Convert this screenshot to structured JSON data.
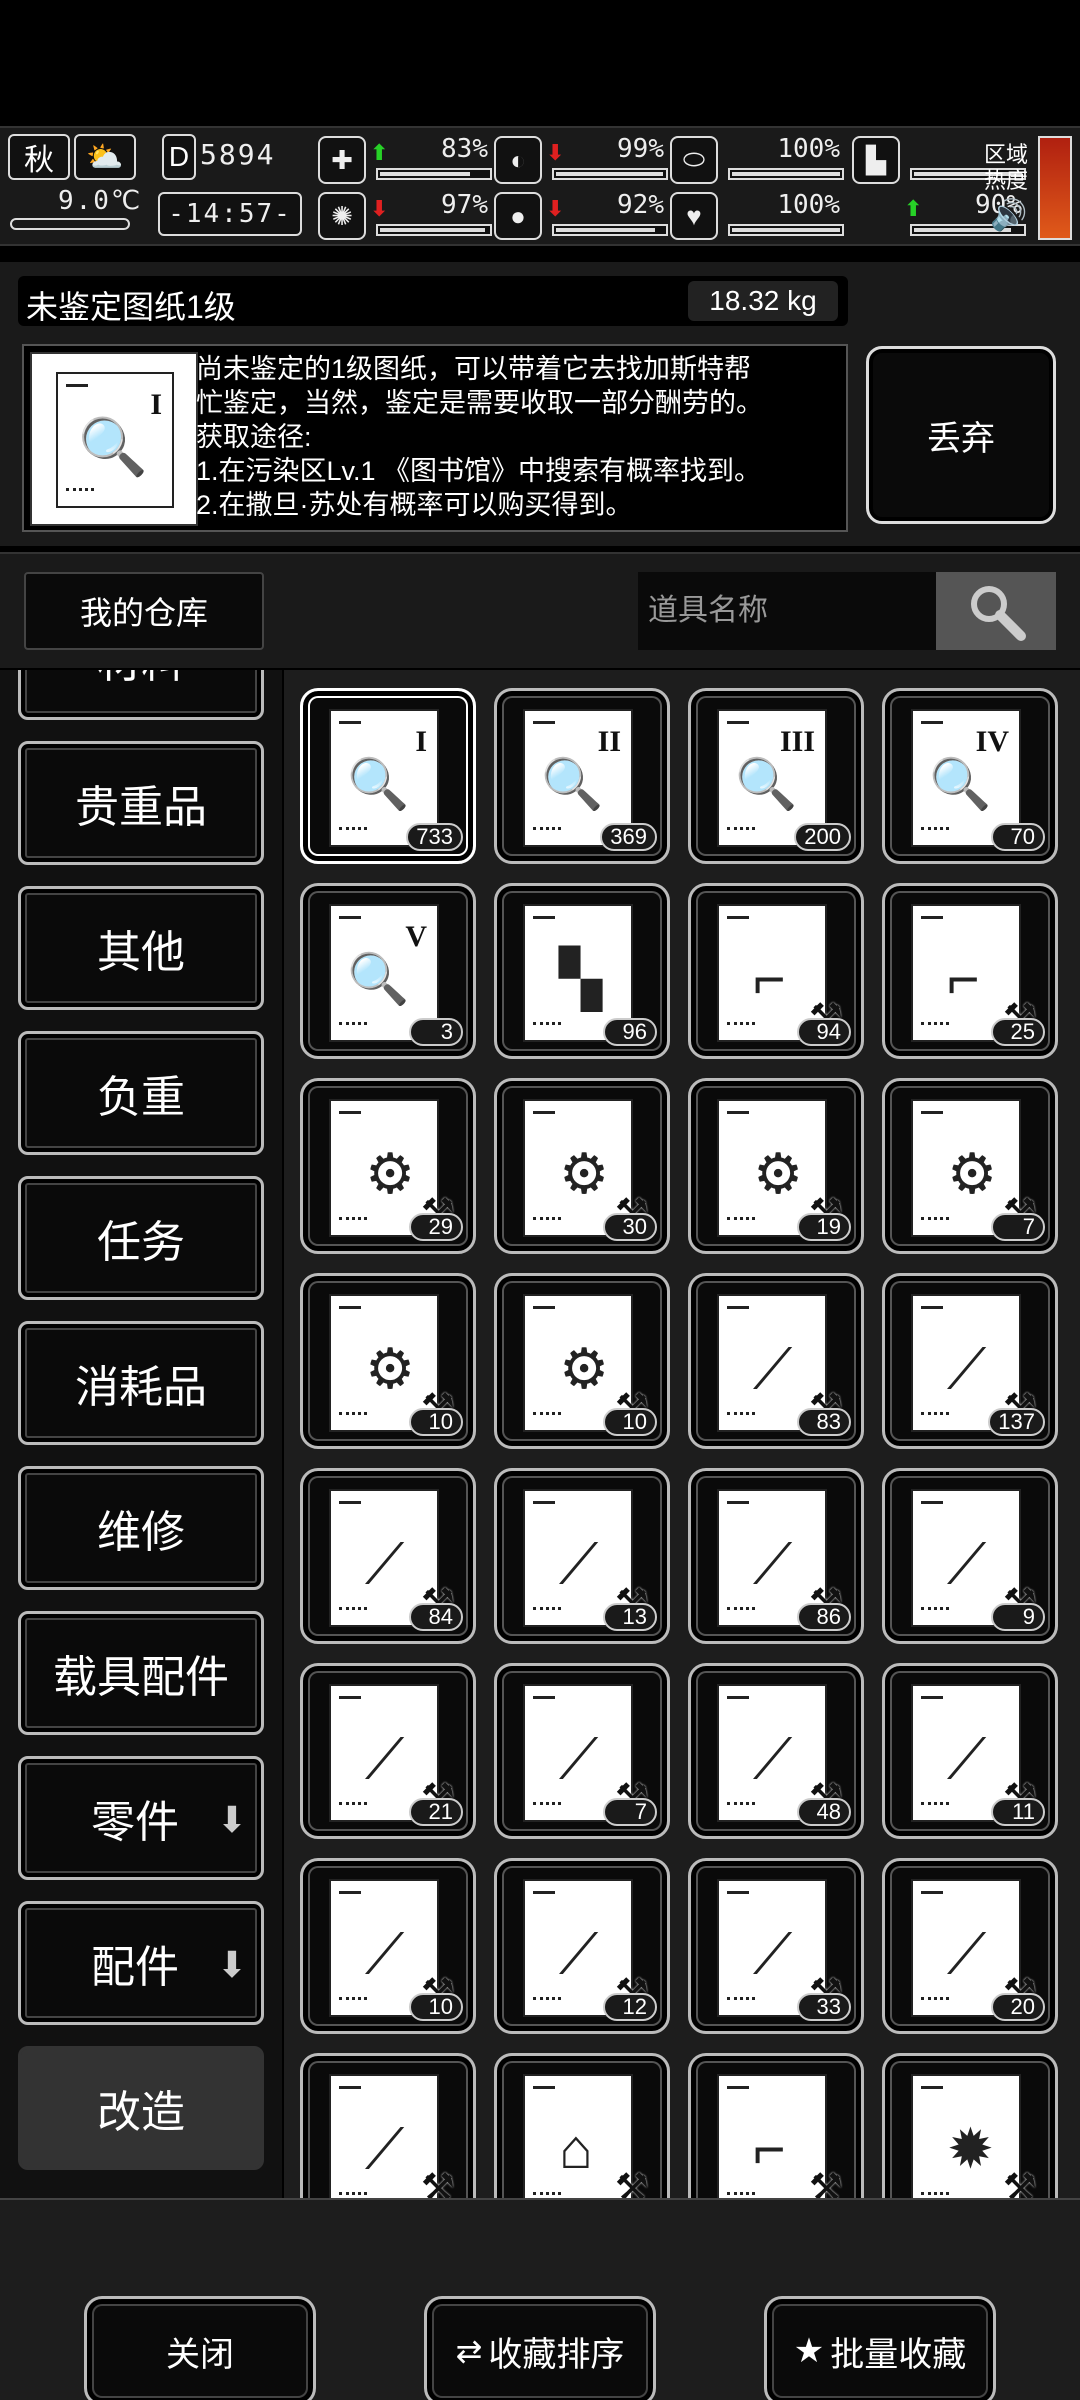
{
  "status": {
    "season": "秋",
    "temperature": "9.0℃",
    "day_counter": "5894",
    "day_prefix": "D",
    "clock": "-14:57-",
    "stats": [
      {
        "name": "health",
        "icon": "medkit-icon",
        "glyph": "✚",
        "trend": "up",
        "percent": "83%",
        "level": 0.83
      },
      {
        "name": "hunger",
        "icon": "stomach-icon",
        "glyph": "◐",
        "trend": "down",
        "percent": "99%",
        "level": 0.99
      },
      {
        "name": "stamina",
        "icon": "pill-icon",
        "glyph": "⬭",
        "trend": "none",
        "percent": "100%",
        "level": 1.0
      },
      {
        "name": "footwear",
        "icon": "boot-icon",
        "glyph": "▙",
        "trend": "none",
        "percent": "",
        "level": 1.0
      },
      {
        "name": "mind",
        "icon": "brain-icon",
        "glyph": "✺",
        "trend": "down",
        "percent": "97%",
        "level": 0.97
      },
      {
        "name": "thirst",
        "icon": "water-drop-icon",
        "glyph": "●",
        "trend": "down",
        "percent": "92%",
        "level": 0.92
      },
      {
        "name": "heart",
        "icon": "heart-icon",
        "glyph": "♥",
        "trend": "none",
        "percent": "100%",
        "level": 1.0
      },
      {
        "name": "energy",
        "icon": "none",
        "glyph": "",
        "trend": "up",
        "percent": "90%",
        "level": 0.9
      }
    ],
    "zone_heat_label": "区域\n热度",
    "zone_heat_color": "#e05a1a"
  },
  "selected_item": {
    "name": "未鉴定图纸1级",
    "weight": "18.32 kg",
    "description": "尚未鉴定的1级图纸，可以带着它去找加斯特帮\n忙鉴定，当然，鉴定是需要收取一部分酬劳的。\n获取途径:\n1.在污染区Lv.1 《图书馆》中搜索有概率找到。\n2.在撒旦·苏处有概率可以购买得到。",
    "roman": "I",
    "discard_label": "丢弃"
  },
  "storage": {
    "title": "我的仓库",
    "search_placeholder": "道具名称"
  },
  "categories": [
    {
      "label": "材料",
      "active": false,
      "arrow": false
    },
    {
      "label": "贵重品",
      "active": false,
      "arrow": false
    },
    {
      "label": "其他",
      "active": false,
      "arrow": false
    },
    {
      "label": "负重",
      "active": false,
      "arrow": false
    },
    {
      "label": "任务",
      "active": false,
      "arrow": false
    },
    {
      "label": "消耗品",
      "active": false,
      "arrow": false
    },
    {
      "label": "维修",
      "active": false,
      "arrow": false
    },
    {
      "label": "载具配件",
      "active": false,
      "arrow": false
    },
    {
      "label": "零件",
      "active": false,
      "arrow": true
    },
    {
      "label": "配件",
      "active": false,
      "arrow": true
    },
    {
      "label": "改造",
      "active": true,
      "arrow": false
    }
  ],
  "items": [
    {
      "kind": "blueprint",
      "roman": "I",
      "count": "733",
      "selected": true
    },
    {
      "kind": "blueprint",
      "roman": "II",
      "count": "369"
    },
    {
      "kind": "blueprint",
      "roman": "III",
      "count": "200"
    },
    {
      "kind": "blueprint",
      "roman": "IV",
      "count": "70"
    },
    {
      "kind": "blueprint",
      "roman": "V",
      "count": "3"
    },
    {
      "kind": "torn",
      "glyph": "▚",
      "count": "96"
    },
    {
      "kind": "mod",
      "glyph": "⌐",
      "count": "94"
    },
    {
      "kind": "mod",
      "glyph": "⌐",
      "count": "25"
    },
    {
      "kind": "mod",
      "glyph": "⚙",
      "count": "29"
    },
    {
      "kind": "mod",
      "glyph": "⚙",
      "count": "30"
    },
    {
      "kind": "mod",
      "glyph": "⚙",
      "count": "19"
    },
    {
      "kind": "mod",
      "glyph": "⚙",
      "count": "7"
    },
    {
      "kind": "mod",
      "glyph": "⚙",
      "count": "10"
    },
    {
      "kind": "mod",
      "glyph": "⚙",
      "count": "10"
    },
    {
      "kind": "mod",
      "glyph": "⟋",
      "count": "83"
    },
    {
      "kind": "mod",
      "glyph": "⟋",
      "count": "137"
    },
    {
      "kind": "mod",
      "glyph": "⟋",
      "count": "84"
    },
    {
      "kind": "mod",
      "glyph": "⟋",
      "count": "13"
    },
    {
      "kind": "mod",
      "glyph": "⟋",
      "count": "86"
    },
    {
      "kind": "mod",
      "glyph": "⟋",
      "count": "9"
    },
    {
      "kind": "mod",
      "glyph": "⟋",
      "count": "21"
    },
    {
      "kind": "mod",
      "glyph": "⟋",
      "count": "7"
    },
    {
      "kind": "mod",
      "glyph": "⟋",
      "count": "48"
    },
    {
      "kind": "mod",
      "glyph": "⟋",
      "count": "11"
    },
    {
      "kind": "mod",
      "glyph": "⟋",
      "count": "10"
    },
    {
      "kind": "mod",
      "glyph": "⟋",
      "count": "12"
    },
    {
      "kind": "mod",
      "glyph": "⟋",
      "count": "33"
    },
    {
      "kind": "mod",
      "glyph": "⟋",
      "count": "20"
    },
    {
      "kind": "mod",
      "glyph": "⟋",
      "count": ""
    },
    {
      "kind": "mod",
      "glyph": "⌂",
      "count": ""
    },
    {
      "kind": "mod",
      "glyph": "⌐",
      "count": ""
    },
    {
      "kind": "mod",
      "glyph": "✹",
      "count": ""
    }
  ],
  "bottom_bar": {
    "close": "关闭",
    "sort_favorites": "收藏排序",
    "sort_icon": "swap-arrows-icon",
    "batch_favorite": "批量收藏",
    "batch_icon": "star-icon"
  }
}
